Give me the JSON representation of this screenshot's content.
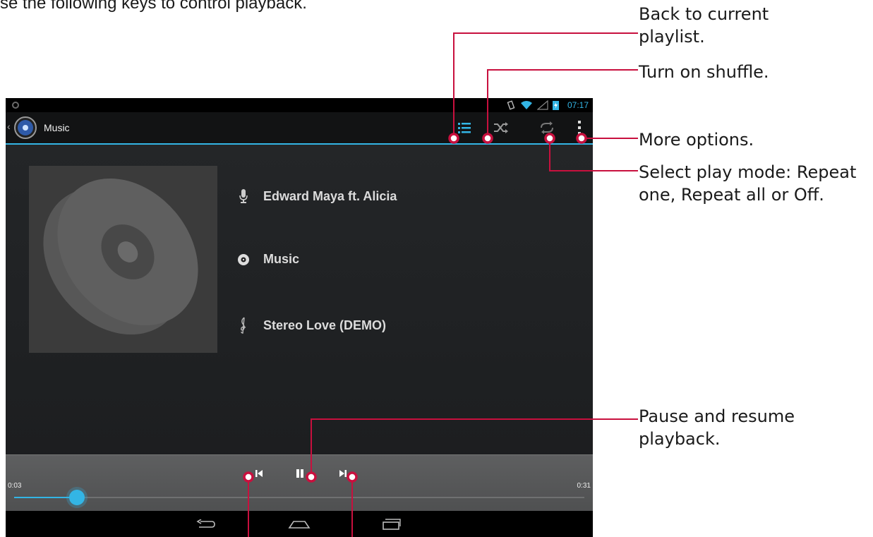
{
  "intro": "se the following keys to control playback.",
  "status_bar": {
    "time": "07:17"
  },
  "action_bar": {
    "title": "Music"
  },
  "track_info": {
    "artist": "Edward Maya ft. Alicia",
    "album": "Music",
    "song": "Stereo Love (DEMO)"
  },
  "playback": {
    "elapsed": "0:03",
    "total": "0:31",
    "progress_fraction": 0.11
  },
  "callouts": {
    "playlist": "Back to current playlist.",
    "shuffle": "Turn on shuffle.",
    "more": "More options.",
    "play_mode": "Select play mode: Repeat one, Repeat all or Off.",
    "pause": "Pause and resume playback."
  },
  "colors": {
    "accent": "#33b5e5",
    "callout_line": "#c8103e"
  },
  "icons": [
    "playlist-icon",
    "shuffle-icon",
    "repeat-icon",
    "overflow-icon",
    "previous-icon",
    "pause-icon",
    "next-icon",
    "microphone-icon",
    "disc-icon",
    "treble-clef-icon",
    "back-nav-icon",
    "home-nav-icon",
    "recents-nav-icon"
  ]
}
